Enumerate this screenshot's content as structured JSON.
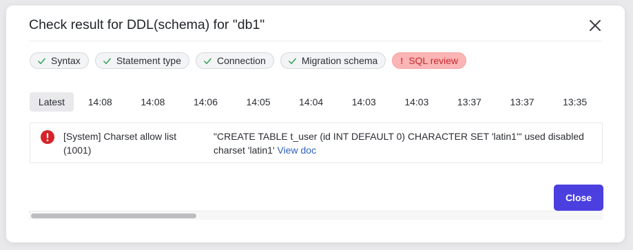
{
  "dialog": {
    "title": "Check result for DDL(schema) for \"db1\"",
    "close_button_label": "Close"
  },
  "checks": [
    {
      "label": "Syntax",
      "status": "success",
      "icon": "check-icon"
    },
    {
      "label": "Statement type",
      "status": "success",
      "icon": "check-icon"
    },
    {
      "label": "Connection",
      "status": "success",
      "icon": "check-icon"
    },
    {
      "label": "Migration schema",
      "status": "success",
      "icon": "check-icon"
    },
    {
      "label": "SQL review",
      "status": "error",
      "icon": "exclamation-icon",
      "marker": "!"
    }
  ],
  "timeline": {
    "active_label": "Latest",
    "times": [
      "14:08",
      "14:08",
      "14:06",
      "14:05",
      "14:04",
      "14:03",
      "14:03",
      "13:37",
      "13:37",
      "13:35"
    ]
  },
  "result": {
    "icon": "error-circle-icon",
    "rule": "[System] Charset allow list (1001)",
    "message": "\"CREATE TABLE t_user (id INT DEFAULT 0) CHARACTER SET 'latin1'\" used disabled charset 'latin1'",
    "link_label": "View doc"
  },
  "scroll": {
    "horizontal_position": 0
  },
  "colors": {
    "primary_button": "#4b3fe0",
    "success_check": "#2f9e52",
    "error_chip_bg": "#fbb5b5",
    "error_icon": "#d5232a",
    "link": "#2e62b8"
  }
}
